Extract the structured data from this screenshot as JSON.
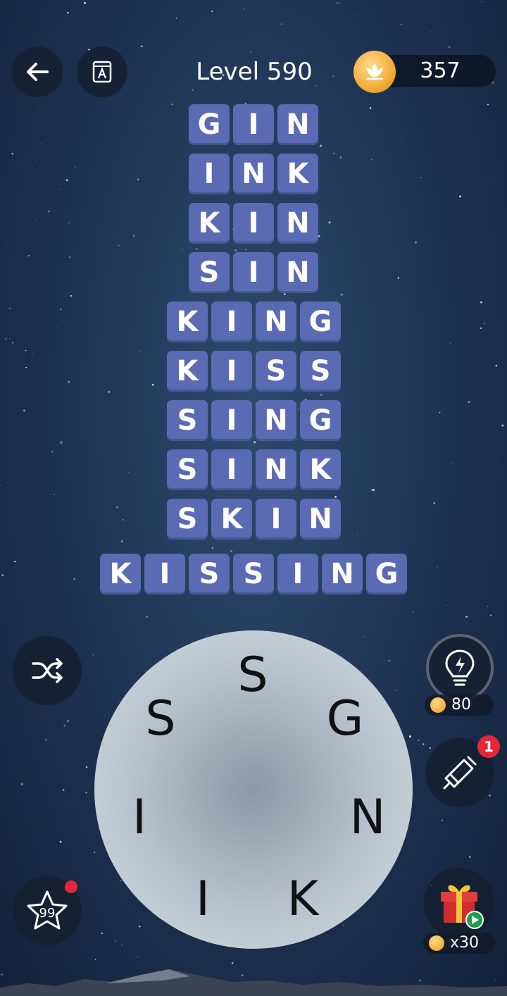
{
  "header": {
    "back_icon": "arrow-left-icon",
    "dictionary_icon": "dictionary-icon",
    "level_label": "Level 590",
    "coin_icon": "lotus-coin-icon",
    "coins": "357"
  },
  "words": [
    {
      "letters": [
        "G",
        "I",
        "N"
      ]
    },
    {
      "letters": [
        "I",
        "N",
        "K"
      ]
    },
    {
      "letters": [
        "K",
        "I",
        "N"
      ]
    },
    {
      "letters": [
        "S",
        "I",
        "N"
      ]
    },
    {
      "letters": [
        "K",
        "I",
        "N",
        "G"
      ]
    },
    {
      "letters": [
        "K",
        "I",
        "S",
        "S"
      ]
    },
    {
      "letters": [
        "S",
        "I",
        "N",
        "G"
      ]
    },
    {
      "letters": [
        "S",
        "I",
        "N",
        "K"
      ]
    },
    {
      "letters": [
        "S",
        "K",
        "I",
        "N"
      ]
    },
    {
      "letters": [
        "K",
        "I",
        "S",
        "S",
        "I",
        "N",
        "G"
      ]
    }
  ],
  "wheel_letters": [
    "S",
    "G",
    "N",
    "K",
    "I",
    "I",
    "S"
  ],
  "controls": {
    "shuffle_icon": "shuffle-icon",
    "hint_icon": "lightbulb-icon",
    "hint_cost": "80",
    "firework_icon": "firework-rocket-icon",
    "firework_badge": "1",
    "gift_icon": "gift-video-icon",
    "gift_reward": "x30",
    "star_icon": "star-icon",
    "star_count": "99"
  },
  "colors": {
    "tile": "#5a6bb3",
    "badge": "#e8253a",
    "coin": "#f2ad3b"
  }
}
